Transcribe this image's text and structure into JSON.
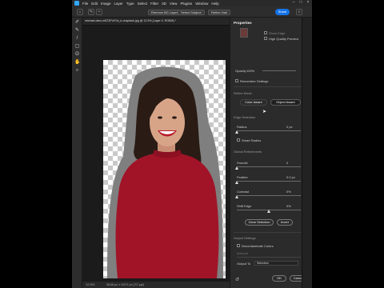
{
  "menubar": {
    "items": [
      "File",
      "Edit",
      "Image",
      "Layer",
      "Type",
      "Select",
      "Filter",
      "3D",
      "View",
      "Plugins",
      "Window",
      "Help"
    ]
  },
  "optionsbar": {
    "remove_label": "Remove BG Layers",
    "select_subject": "Select Subject",
    "refine_label": "Refine Hair",
    "share_label": "Share"
  },
  "document": {
    "tab_title": "michael-dam-mEZ3PoFGs_k-unsplash.jpg @ 12.5% (Layer 0, RGB/8) *"
  },
  "status": {
    "zoom": "12.5%",
    "info": "3648 px x 5472 px (72 ppi)"
  },
  "properties": {
    "title": "Properties",
    "show_edge_label": "Show Edge",
    "high_quality_label": "High Quality Preview",
    "opacity_label": "Opacity",
    "opacity_value": "100%",
    "remember_label": "Remember Settings",
    "refine_mode_label": "Refine Mode",
    "color_aware": "Color Aware",
    "object_aware": "Object Aware",
    "edge_detection": "Edge Detection",
    "radius_label": "Radius",
    "radius_value": "0 px",
    "smart_radius": "Smart Radius",
    "global_refinements": "Global Refinements",
    "smooth_label": "Smooth",
    "smooth_value": "0",
    "feather_label": "Feather",
    "feather_value": "0.0 px",
    "contrast_label": "Contrast",
    "contrast_value": "0%",
    "shift_label": "Shift Edge",
    "shift_value": "0%",
    "clear_selection": "Clear Selection",
    "invert": "Invert",
    "output_settings": "Output Settings",
    "decontaminate": "Decontaminate Colors",
    "amount_label": "Amount",
    "output_to_label": "Output To",
    "output_to_value": "Selection",
    "ok": "OK",
    "cancel": "Cancel"
  },
  "colors": {
    "accent": "#1473e6",
    "sweater": "#a11428",
    "skin": "#d8a488",
    "hair": "#2a1b15"
  },
  "sliders": {
    "radius": 0.0,
    "smooth": 0.0,
    "feather": 0.0,
    "contrast": 0.0,
    "shift": 0.5
  }
}
